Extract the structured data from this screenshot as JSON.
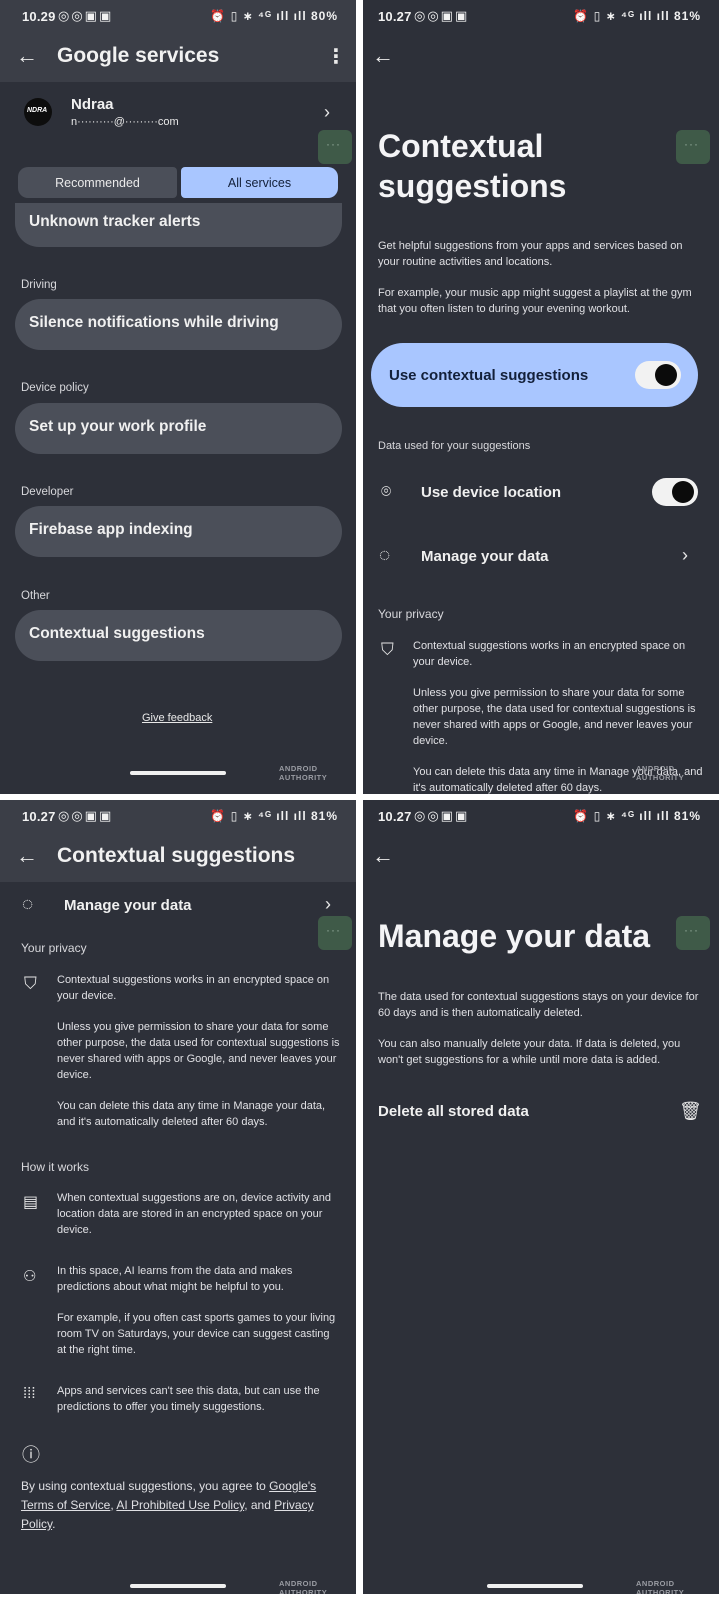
{
  "panel1": {
    "status": {
      "time": "10.29",
      "left_icons": "◎◎▣▣",
      "right_icons": "⏰ ▯ ∗ ⁴ᴳ ıll ıll 80%"
    },
    "title": "Google services",
    "account_name": "Ndraa",
    "account_email": "n··········@·········com",
    "tabs": [
      "Recommended",
      "All services"
    ],
    "items": [
      {
        "section": "",
        "label": "Unknown tracker alerts"
      },
      {
        "section": "Driving",
        "label": "Silence notifications while driving"
      },
      {
        "section": "Device policy",
        "label": "Set up your work profile"
      },
      {
        "section": "Developer",
        "label": "Firebase app indexing"
      },
      {
        "section": "Other",
        "label": "Contextual suggestions"
      }
    ],
    "feedback": "Give feedback",
    "watermark": "ANDROID AUTHORITY"
  },
  "panel2": {
    "status": {
      "time": "10.27",
      "left_icons": "◎◎▣▣",
      "right_icons": "⏰ ▯ ∗ ⁴ᴳ ıll ıll 81%"
    },
    "title_line1": "Contextual",
    "title_line2": "suggestions",
    "desc1": "Get helpful suggestions from your apps and services based on your routine activities and locations.",
    "desc2": "For example, your music app might suggest a playlist at the gym that you often listen to during your evening workout.",
    "main_toggle_label": "Use contextual suggestions",
    "data_section": "Data used for your suggestions",
    "location_label": "Use device location",
    "manage_label": "Manage your data",
    "privacy_section": "Your privacy",
    "privacy1": "Contextual suggestions works in an encrypted space on your device.",
    "privacy2": "Unless you give permission to share your data for some other purpose, the data used for contextual suggestions is never shared with apps or Google, and never leaves your device.",
    "privacy3": "You can delete this data any time in Manage your data, and it's automatically deleted after 60 days.",
    "watermark": "ANDROID AUTHORITY"
  },
  "panel3": {
    "status": {
      "time": "10.27",
      "left_icons": "◎◎▣▣",
      "right_icons": "⏰ ▯ ∗ ⁴ᴳ ıll ıll 81%"
    },
    "title": "Contextual suggestions",
    "manage_label": "Manage your data",
    "privacy_section": "Your privacy",
    "privacy1": "Contextual suggestions works in an encrypted space on your device.",
    "privacy2": "Unless you give permission to share your data for some other purpose, the data used for contextual suggestions is never shared with apps or Google, and never leaves your device.",
    "privacy3": "You can delete this data any time in Manage your data, and it's automatically deleted after 60 days.",
    "how_section": "How it works",
    "how1": "When contextual suggestions are on, device activity and location data are stored in an encrypted space on your device.",
    "how2": "In this space, AI learns from the data and makes predictions about what might be helpful to you.",
    "how3": "For example, if you often cast sports games to your living room TV on Saturdays, your device can suggest casting at the right time.",
    "how4": "Apps and services can't see this data, but can use the predictions to offer you timely suggestions.",
    "terms_prefix": "By using contextual suggestions, you agree to ",
    "terms_link1": "Google's Terms of Service",
    "terms_sep1": ", ",
    "terms_link2": "AI Prohibited Use Policy",
    "terms_sep2": ", and ",
    "terms_link3": "Privacy Policy",
    "terms_suffix": ".",
    "watermark": "ANDROID AUTHORITY"
  },
  "panel4": {
    "status": {
      "time": "10.27",
      "left_icons": "◎◎▣▣",
      "right_icons": "⏰ ▯ ∗ ⁴ᴳ ıll ıll 81%"
    },
    "title": "Manage your data",
    "desc1": "The data used for contextual suggestions stays on your device for 60 days and is then automatically deleted.",
    "desc2": "You can also manually delete your data. If data is deleted, you won't get suggestions for a while until more data is added.",
    "delete_label": "Delete all stored data",
    "watermark": "ANDROID AUTHORITY"
  }
}
